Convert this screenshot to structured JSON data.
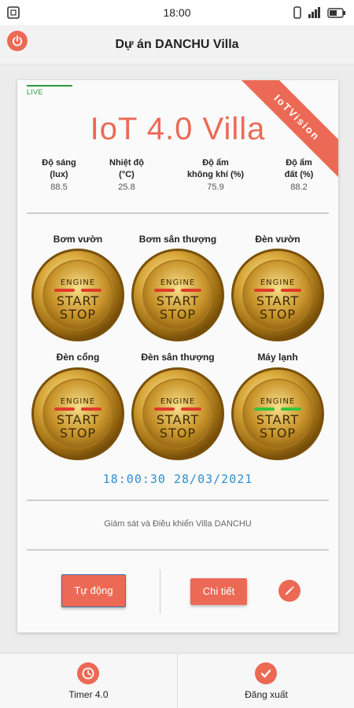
{
  "status_bar": {
    "time": "18:00",
    "icons": [
      "screenshot-icon",
      "vibrate-icon",
      "signal-icon",
      "battery-icon"
    ]
  },
  "app_bar": {
    "title": "Dự án DANCHU Villa",
    "left_icon": "power-icon"
  },
  "card": {
    "live_label": "LIVE",
    "ribbon_text": "IoTVision",
    "headline": "IoT 4.0 Villa",
    "sensors": [
      {
        "label_line1": "Độ sáng",
        "label_line2": "(lux)",
        "value": "88.5"
      },
      {
        "label_line1": "Nhiệt độ",
        "label_line2": "(°C)",
        "value": "25.8"
      },
      {
        "label_line1": "Độ ẩm",
        "label_line2": "không khí (%)",
        "value": "75.9"
      },
      {
        "label_line1": "Độ ẩm",
        "label_line2": "đất (%)",
        "value": "88.2"
      }
    ],
    "devices": [
      {
        "label": "Bơm vườn",
        "state": "off",
        "engine_text": "ENGINE",
        "start_text": "START",
        "stop_text": "STOP"
      },
      {
        "label": "Bơm sân thượng",
        "state": "off",
        "engine_text": "ENGINE",
        "start_text": "START",
        "stop_text": "STOP"
      },
      {
        "label": "Đèn vườn",
        "state": "off",
        "engine_text": "ENGINE",
        "start_text": "START",
        "stop_text": "STOP"
      },
      {
        "label": "Đèn cổng",
        "state": "off",
        "engine_text": "ENGINE",
        "start_text": "START",
        "stop_text": "STOP"
      },
      {
        "label": "Đèn sân thượng",
        "state": "off",
        "engine_text": "ENGINE",
        "start_text": "START",
        "stop_text": "STOP"
      },
      {
        "label": "Máy lạnh",
        "state": "on",
        "engine_text": "ENGINE",
        "start_text": "START",
        "stop_text": "STOP"
      }
    ],
    "clock": "18:00:30 28/03/2021",
    "footer_text": "Giám sát và Điều khiển Villa DANCHU",
    "auto_button": "Tự động",
    "detail_button": "Chi tiết",
    "edit_icon": "pencil-icon"
  },
  "bottom_nav": [
    {
      "label": "Timer 4.0",
      "icon": "clock-icon"
    },
    {
      "label": "Đăng xuất",
      "icon": "check-icon"
    }
  ],
  "colors": {
    "accent": "#ec6a55",
    "live": "#2b9a3c",
    "clock": "#2f8fd0",
    "led_off": "#e03a2a",
    "led_on": "#38c43a"
  }
}
